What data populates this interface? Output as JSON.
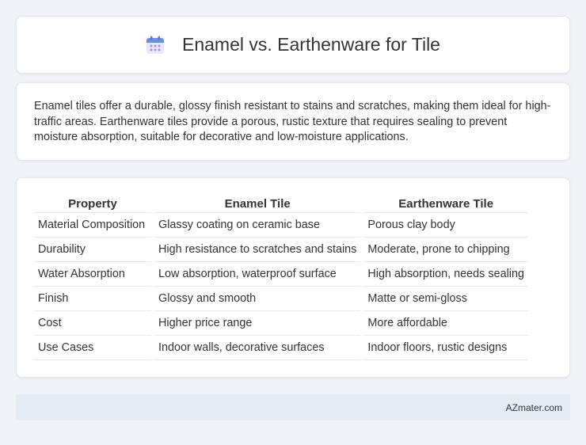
{
  "header": {
    "title": "Enamel vs. Earthenware for Tile",
    "icon": "calendar-icon",
    "icon_colors": {
      "top": "#6b8fe8",
      "body": "#ebe7fb",
      "dots": "#a48fe6"
    }
  },
  "summary": {
    "text": "Enamel tiles offer a durable, glossy finish resistant to stains and scratches, making them ideal for high-traffic areas. Earthenware tiles provide a porous, rustic texture that requires sealing to prevent moisture absorption, suitable for decorative and low-moisture applications."
  },
  "table": {
    "headers": [
      "Property",
      "Enamel Tile",
      "Earthenware Tile"
    ],
    "rows": [
      [
        "Material Composition",
        "Glassy coating on ceramic base",
        "Porous clay body"
      ],
      [
        "Durability",
        "High resistance to scratches and stains",
        "Moderate, prone to chipping"
      ],
      [
        "Water Absorption",
        "Low absorption, waterproof surface",
        "High absorption, needs sealing"
      ],
      [
        "Finish",
        "Glossy and smooth",
        "Matte or semi-gloss"
      ],
      [
        "Cost",
        "Higher price range",
        "More affordable"
      ],
      [
        "Use Cases",
        "Indoor walls, decorative surfaces",
        "Indoor floors, rustic designs"
      ]
    ]
  },
  "footer": {
    "site": "AZmater.com"
  }
}
